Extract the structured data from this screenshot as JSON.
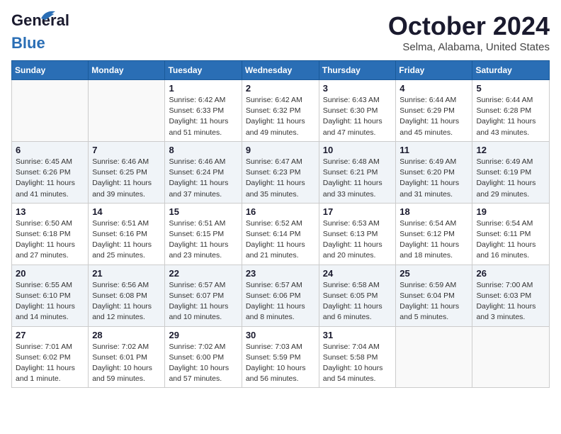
{
  "header": {
    "logo_line1": "General",
    "logo_line2": "Blue",
    "month": "October 2024",
    "location": "Selma, Alabama, United States"
  },
  "columns": [
    "Sunday",
    "Monday",
    "Tuesday",
    "Wednesday",
    "Thursday",
    "Friday",
    "Saturday"
  ],
  "weeks": [
    {
      "shaded": false,
      "days": [
        {
          "num": "",
          "detail": ""
        },
        {
          "num": "",
          "detail": ""
        },
        {
          "num": "1",
          "detail": "Sunrise: 6:42 AM\nSunset: 6:33 PM\nDaylight: 11 hours\nand 51 minutes."
        },
        {
          "num": "2",
          "detail": "Sunrise: 6:42 AM\nSunset: 6:32 PM\nDaylight: 11 hours\nand 49 minutes."
        },
        {
          "num": "3",
          "detail": "Sunrise: 6:43 AM\nSunset: 6:30 PM\nDaylight: 11 hours\nand 47 minutes."
        },
        {
          "num": "4",
          "detail": "Sunrise: 6:44 AM\nSunset: 6:29 PM\nDaylight: 11 hours\nand 45 minutes."
        },
        {
          "num": "5",
          "detail": "Sunrise: 6:44 AM\nSunset: 6:28 PM\nDaylight: 11 hours\nand 43 minutes."
        }
      ]
    },
    {
      "shaded": true,
      "days": [
        {
          "num": "6",
          "detail": "Sunrise: 6:45 AM\nSunset: 6:26 PM\nDaylight: 11 hours\nand 41 minutes."
        },
        {
          "num": "7",
          "detail": "Sunrise: 6:46 AM\nSunset: 6:25 PM\nDaylight: 11 hours\nand 39 minutes."
        },
        {
          "num": "8",
          "detail": "Sunrise: 6:46 AM\nSunset: 6:24 PM\nDaylight: 11 hours\nand 37 minutes."
        },
        {
          "num": "9",
          "detail": "Sunrise: 6:47 AM\nSunset: 6:23 PM\nDaylight: 11 hours\nand 35 minutes."
        },
        {
          "num": "10",
          "detail": "Sunrise: 6:48 AM\nSunset: 6:21 PM\nDaylight: 11 hours\nand 33 minutes."
        },
        {
          "num": "11",
          "detail": "Sunrise: 6:49 AM\nSunset: 6:20 PM\nDaylight: 11 hours\nand 31 minutes."
        },
        {
          "num": "12",
          "detail": "Sunrise: 6:49 AM\nSunset: 6:19 PM\nDaylight: 11 hours\nand 29 minutes."
        }
      ]
    },
    {
      "shaded": false,
      "days": [
        {
          "num": "13",
          "detail": "Sunrise: 6:50 AM\nSunset: 6:18 PM\nDaylight: 11 hours\nand 27 minutes."
        },
        {
          "num": "14",
          "detail": "Sunrise: 6:51 AM\nSunset: 6:16 PM\nDaylight: 11 hours\nand 25 minutes."
        },
        {
          "num": "15",
          "detail": "Sunrise: 6:51 AM\nSunset: 6:15 PM\nDaylight: 11 hours\nand 23 minutes."
        },
        {
          "num": "16",
          "detail": "Sunrise: 6:52 AM\nSunset: 6:14 PM\nDaylight: 11 hours\nand 21 minutes."
        },
        {
          "num": "17",
          "detail": "Sunrise: 6:53 AM\nSunset: 6:13 PM\nDaylight: 11 hours\nand 20 minutes."
        },
        {
          "num": "18",
          "detail": "Sunrise: 6:54 AM\nSunset: 6:12 PM\nDaylight: 11 hours\nand 18 minutes."
        },
        {
          "num": "19",
          "detail": "Sunrise: 6:54 AM\nSunset: 6:11 PM\nDaylight: 11 hours\nand 16 minutes."
        }
      ]
    },
    {
      "shaded": true,
      "days": [
        {
          "num": "20",
          "detail": "Sunrise: 6:55 AM\nSunset: 6:10 PM\nDaylight: 11 hours\nand 14 minutes."
        },
        {
          "num": "21",
          "detail": "Sunrise: 6:56 AM\nSunset: 6:08 PM\nDaylight: 11 hours\nand 12 minutes."
        },
        {
          "num": "22",
          "detail": "Sunrise: 6:57 AM\nSunset: 6:07 PM\nDaylight: 11 hours\nand 10 minutes."
        },
        {
          "num": "23",
          "detail": "Sunrise: 6:57 AM\nSunset: 6:06 PM\nDaylight: 11 hours\nand 8 minutes."
        },
        {
          "num": "24",
          "detail": "Sunrise: 6:58 AM\nSunset: 6:05 PM\nDaylight: 11 hours\nand 6 minutes."
        },
        {
          "num": "25",
          "detail": "Sunrise: 6:59 AM\nSunset: 6:04 PM\nDaylight: 11 hours\nand 5 minutes."
        },
        {
          "num": "26",
          "detail": "Sunrise: 7:00 AM\nSunset: 6:03 PM\nDaylight: 11 hours\nand 3 minutes."
        }
      ]
    },
    {
      "shaded": false,
      "days": [
        {
          "num": "27",
          "detail": "Sunrise: 7:01 AM\nSunset: 6:02 PM\nDaylight: 11 hours\nand 1 minute."
        },
        {
          "num": "28",
          "detail": "Sunrise: 7:02 AM\nSunset: 6:01 PM\nDaylight: 10 hours\nand 59 minutes."
        },
        {
          "num": "29",
          "detail": "Sunrise: 7:02 AM\nSunset: 6:00 PM\nDaylight: 10 hours\nand 57 minutes."
        },
        {
          "num": "30",
          "detail": "Sunrise: 7:03 AM\nSunset: 5:59 PM\nDaylight: 10 hours\nand 56 minutes."
        },
        {
          "num": "31",
          "detail": "Sunrise: 7:04 AM\nSunset: 5:58 PM\nDaylight: 10 hours\nand 54 minutes."
        },
        {
          "num": "",
          "detail": ""
        },
        {
          "num": "",
          "detail": ""
        }
      ]
    }
  ]
}
